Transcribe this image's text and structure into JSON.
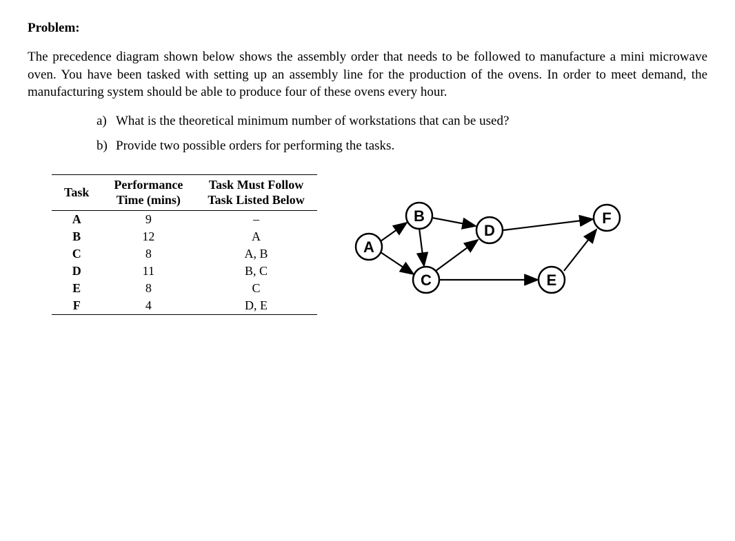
{
  "title": "Problem:",
  "paragraph": "The precedence diagram shown below shows the assembly order that needs to be followed to manufacture a mini microwave oven.  You have been tasked with setting up an assembly line for the production of the ovens. In order to meet demand, the manufacturing system should be able to produce four of these ovens every hour.",
  "questions": {
    "a_marker": "a)",
    "a_text": "What is the theoretical minimum number of workstations that can be used?",
    "b_marker": "b)",
    "b_text": "Provide two possible orders for performing the tasks."
  },
  "table": {
    "headers": {
      "task": "Task",
      "perf_line1": "Performance",
      "perf_line2": "Time (mins)",
      "follow_line1": "Task Must Follow",
      "follow_line2": "Task Listed Below"
    },
    "rows": [
      {
        "task": "A",
        "time": "9",
        "follow": "–"
      },
      {
        "task": "B",
        "time": "12",
        "follow": "A"
      },
      {
        "task": "C",
        "time": "8",
        "follow": "A, B"
      },
      {
        "task": "D",
        "time": "11",
        "follow": "B, C"
      },
      {
        "task": "E",
        "time": "8",
        "follow": "C"
      },
      {
        "task": "F",
        "time": "4",
        "follow": "D, E"
      }
    ]
  },
  "diagram": {
    "nodes": {
      "A": "A",
      "B": "B",
      "C": "C",
      "D": "D",
      "E": "E",
      "F": "F"
    },
    "edges": [
      [
        "A",
        "B"
      ],
      [
        "A",
        "C"
      ],
      [
        "B",
        "C"
      ],
      [
        "B",
        "D"
      ],
      [
        "C",
        "D"
      ],
      [
        "C",
        "E"
      ],
      [
        "D",
        "F"
      ],
      [
        "E",
        "F"
      ]
    ]
  }
}
